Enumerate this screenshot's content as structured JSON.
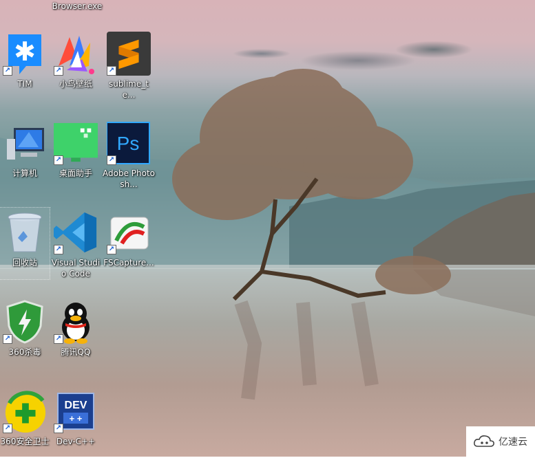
{
  "desktop": {
    "top_partial_label": "Browser.exe",
    "icons": [
      {
        "label": "TIM"
      },
      {
        "label": "小鸟壁纸"
      },
      {
        "label": "sublime_te..."
      },
      {
        "label": "计算机"
      },
      {
        "label": "桌面助手"
      },
      {
        "label": "Adobe Photosh..."
      },
      {
        "label": "回收站"
      },
      {
        "label": "Visual Studio Code"
      },
      {
        "label": "FSCapture..."
      },
      {
        "label": "360杀毒"
      },
      {
        "label": "腾讯QQ"
      },
      {
        "label": "360安全卫士"
      },
      {
        "label": "Dev-C++"
      }
    ]
  },
  "watermark": {
    "text": "亿速云"
  },
  "icon_glyphs": {
    "shortcut": "↗",
    "photoshop": "Ps",
    "dev": "DEV"
  }
}
